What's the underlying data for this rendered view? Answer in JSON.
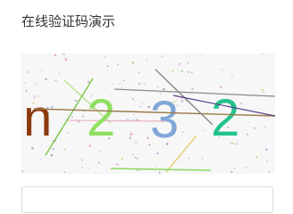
{
  "page": {
    "title": "在线验证码演示"
  },
  "captcha": {
    "characters": [
      {
        "char": "n",
        "color": "#8b3a0f"
      },
      {
        "char": "2",
        "color": "#90e060"
      },
      {
        "char": "3",
        "color": "#7fa6d8"
      },
      {
        "char": "2",
        "color": "#22c28f"
      }
    ],
    "background": "#f7f7f7"
  },
  "input": {
    "value": "",
    "placeholder": ""
  }
}
